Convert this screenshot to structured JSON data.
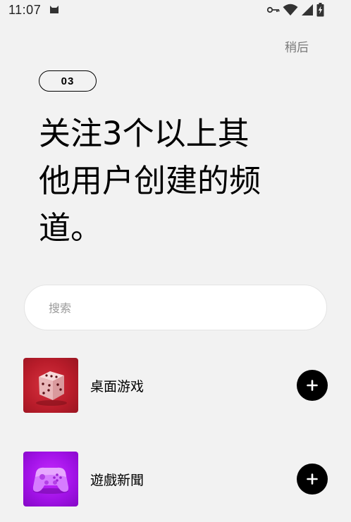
{
  "status_bar": {
    "time": "11:07",
    "icons": [
      "cat-icon",
      "key-icon",
      "wifi-icon",
      "signal-icon",
      "battery-charging-icon"
    ]
  },
  "header": {
    "later_label": "稍后"
  },
  "step": {
    "label": "03"
  },
  "title": {
    "line1": "关注3个以上其",
    "line2": "他用户创建的频",
    "line3": "道。"
  },
  "search": {
    "placeholder": "搜索",
    "value": ""
  },
  "channels": [
    {
      "name": "桌面游戏",
      "icon": "dice-icon",
      "color": "#c0202e"
    },
    {
      "name": "遊戲新聞",
      "icon": "gamepad-icon",
      "color": "#a514e6"
    }
  ],
  "colors": {
    "background": "#f2f2f2",
    "add_button": "#000000"
  }
}
